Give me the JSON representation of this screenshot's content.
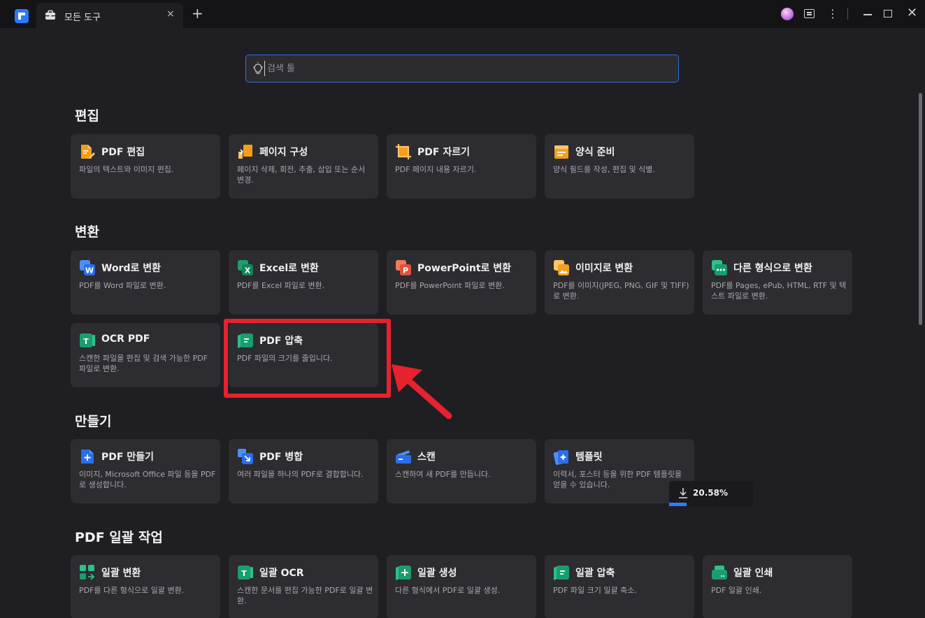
{
  "titlebar": {
    "tab_title": "모든 도구",
    "tab_close": "×",
    "new_tab": "+",
    "more": "⋮",
    "close": "✕"
  },
  "search": {
    "placeholder": "검색 툴"
  },
  "sections": {
    "edit": {
      "title": "편집",
      "cards": [
        {
          "title": "PDF 편집",
          "desc": "파일의 텍스트와 이미지 편집.",
          "icon": "pdf-edit-icon"
        },
        {
          "title": "페이지 구성",
          "desc": "페이지 삭제, 회전, 추출, 삽입 또는 순서 변경.",
          "icon": "page-organize-icon"
        },
        {
          "title": "PDF 자르기",
          "desc": "PDF 페이지 내용 자르기.",
          "icon": "crop-icon"
        },
        {
          "title": "양식 준비",
          "desc": "양식 필드를 작성, 편집 및 식별.",
          "icon": "form-icon"
        }
      ]
    },
    "convert": {
      "title": "변환",
      "cards": [
        {
          "title": "Word로 변환",
          "desc": "PDF를 Word 파일로 변환.",
          "icon": "word-icon"
        },
        {
          "title": "Excel로 변환",
          "desc": "PDF를 Excel 파일로 변환.",
          "icon": "excel-icon"
        },
        {
          "title": "PowerPoint로 변환",
          "desc": "PDF를 PowerPoint 파일로 변환.",
          "icon": "powerpoint-icon"
        },
        {
          "title": "이미지로 변환",
          "desc": "PDF를 이미지(JPEG, PNG, GIF 및 TIFF)로 변환.",
          "icon": "image-icon"
        },
        {
          "title": "다른 형식으로 변환",
          "desc": "PDF를 Pages, ePub, HTML, RTF 및 텍스트 파일로 변환.",
          "icon": "other-format-icon"
        },
        {
          "title": "OCR PDF",
          "desc": "스캔한 파일을 편집 및 검색 가능한 PDF 파일로 변환.",
          "icon": "ocr-icon"
        },
        {
          "title": "PDF 압축",
          "desc": "PDF 파일의 크기를 줄입니다.",
          "icon": "compress-icon"
        }
      ]
    },
    "create": {
      "title": "만들기",
      "cards": [
        {
          "title": "PDF 만들기",
          "desc": "이미지, Microsoft Office 파일 등을 PDF로 생성합니다.",
          "icon": "create-pdf-icon"
        },
        {
          "title": "PDF 병합",
          "desc": "여러 파일을 하나의 PDF로 결합합니다.",
          "icon": "merge-icon"
        },
        {
          "title": "스캔",
          "desc": "스캔하여 새 PDF를 만듭니다.",
          "icon": "scan-icon"
        },
        {
          "title": "템플릿",
          "desc": "이력서, 포스터 등을 위한 PDF 템플릿을 얻을 수 있습니다.",
          "icon": "template-icon"
        }
      ]
    },
    "batch": {
      "title": "PDF 일괄 작업",
      "cards": [
        {
          "title": "일괄 변환",
          "desc": "PDF를 다른 형식으로 일괄 변환.",
          "icon": "batch-convert-icon"
        },
        {
          "title": "일괄 OCR",
          "desc": "스캔한 문서를 편집 가능한 PDF로 일괄 변환.",
          "icon": "batch-ocr-icon"
        },
        {
          "title": "일괄 생성",
          "desc": "다른 형식에서 PDF로 일괄 생성.",
          "icon": "batch-create-icon"
        },
        {
          "title": "일괄 압축",
          "desc": "PDF 파일 크기 일괄 축소.",
          "icon": "batch-compress-icon"
        },
        {
          "title": "일괄 인쇄",
          "desc": "PDF 일괄 인쇄.",
          "icon": "batch-print-icon"
        }
      ]
    }
  },
  "download": {
    "percent_label": "20.58%",
    "progress": 0.2058,
    "color": "#2e7cf6"
  },
  "colors": {
    "accent": "#2a7bff",
    "highlight": "#e8212e",
    "card_bg": "#2c2c31"
  }
}
